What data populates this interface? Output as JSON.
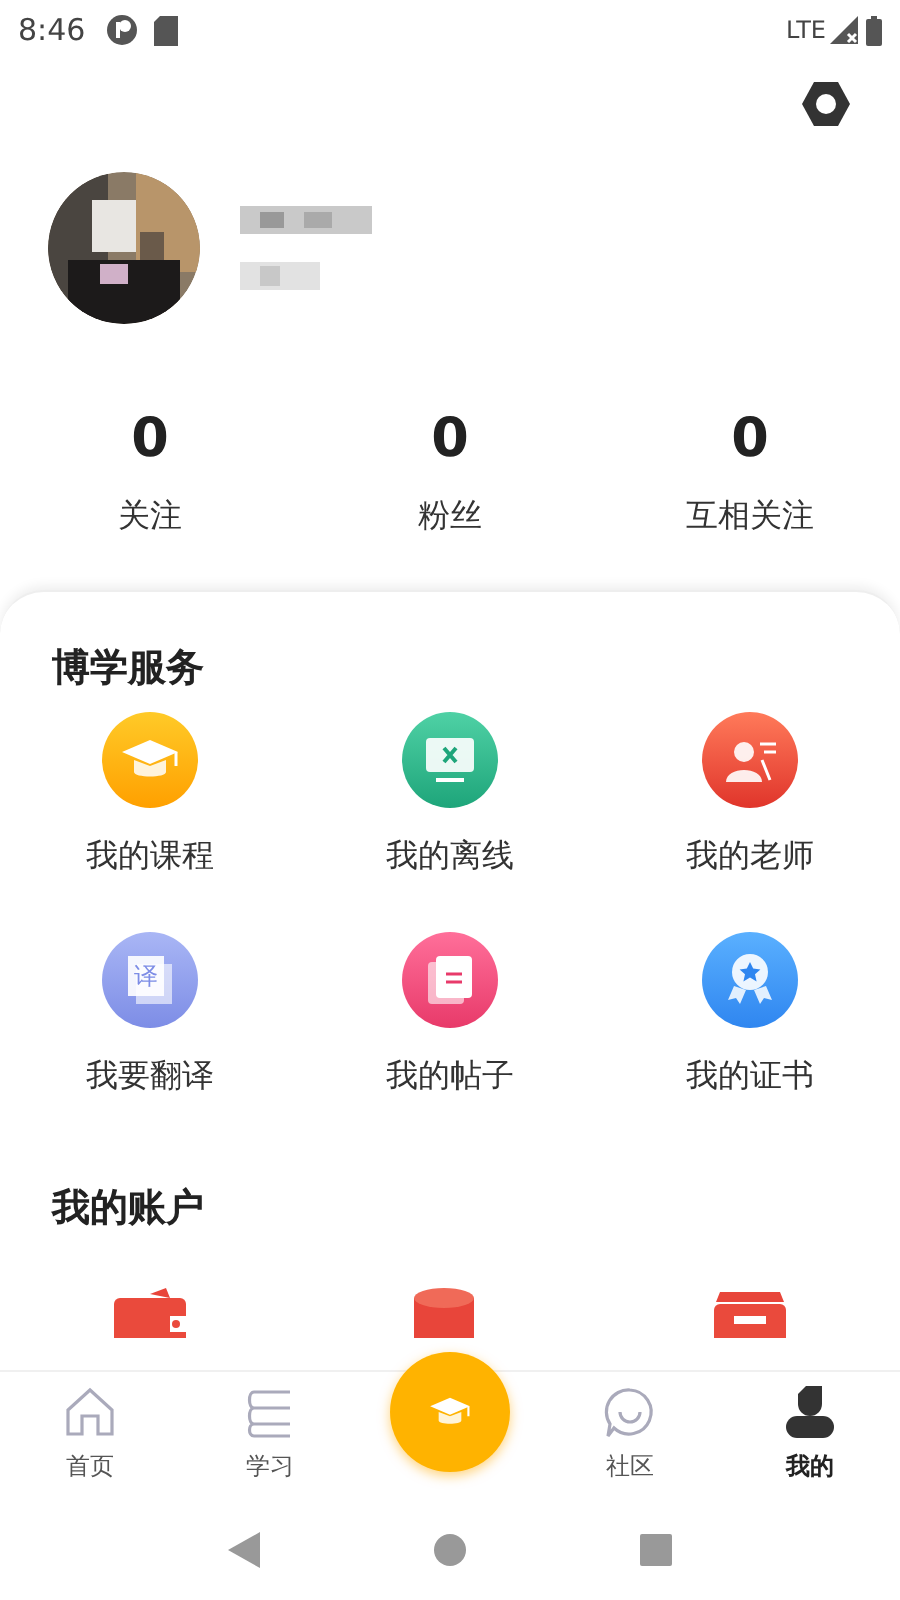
{
  "status_bar": {
    "time": "8:46",
    "network": "LTE"
  },
  "stats": [
    {
      "value": "0",
      "label": "关注"
    },
    {
      "value": "0",
      "label": "粉丝"
    },
    {
      "value": "0",
      "label": "互相关注"
    }
  ],
  "services": {
    "title": "博学服务",
    "items": [
      {
        "label": "我的课程",
        "kind": "course"
      },
      {
        "label": "我的离线",
        "kind": "offline"
      },
      {
        "label": "我的老师",
        "kind": "teacher"
      },
      {
        "label": "我要翻译",
        "kind": "translate",
        "icon_text": "译"
      },
      {
        "label": "我的帖子",
        "kind": "posts"
      },
      {
        "label": "我的证书",
        "kind": "certificate"
      }
    ]
  },
  "account": {
    "title": "我的账户",
    "items": [
      {
        "kind": "wallet"
      },
      {
        "kind": "coins"
      },
      {
        "kind": "ticket"
      }
    ]
  },
  "tab_bar": [
    {
      "label": "首页",
      "kind": "home",
      "selected": false
    },
    {
      "label": "学习",
      "kind": "study",
      "selected": false
    },
    {
      "kind": "center",
      "selected": false
    },
    {
      "label": "社区",
      "kind": "community",
      "selected": false
    },
    {
      "label": "我的",
      "kind": "me",
      "selected": true
    }
  ]
}
